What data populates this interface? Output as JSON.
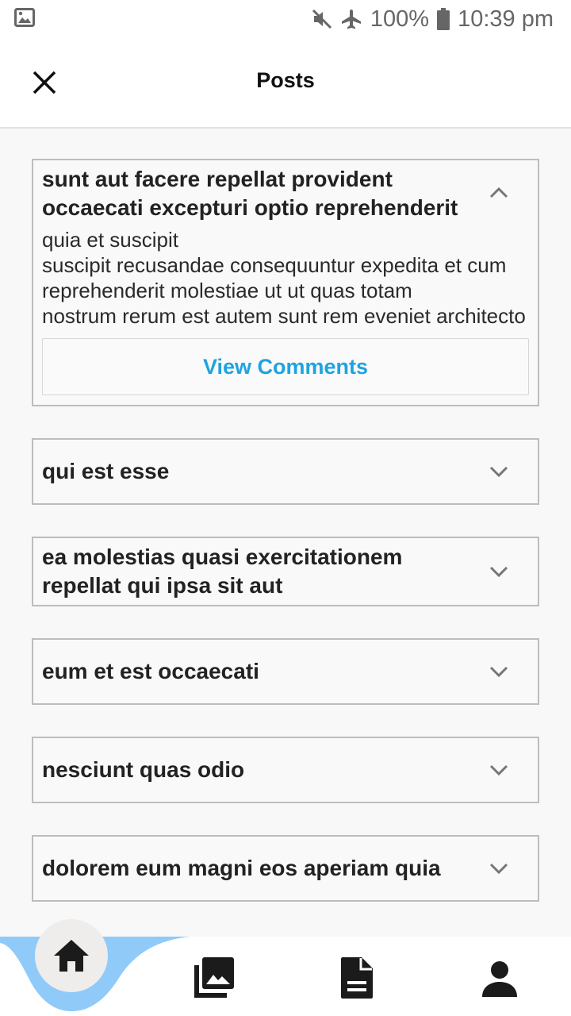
{
  "status_bar": {
    "battery_text": "100%",
    "time": "10:39 pm",
    "icons": [
      "image-icon",
      "mute-icon",
      "airplane-icon",
      "battery-icon"
    ]
  },
  "app_bar": {
    "title": "Posts",
    "close_icon": "close-icon"
  },
  "posts": [
    {
      "title": "sunt aut facere repellat provident occaecati excepturi optio reprehenderit",
      "body": "quia et suscipit\nsuscipit recusandae consequuntur expedita et cum\nreprehenderit molestiae ut ut quas totam\nnostrum rerum est autem sunt rem eveniet architecto",
      "expanded": true,
      "action_label": "View Comments"
    },
    {
      "title": "qui est esse",
      "expanded": false
    },
    {
      "title": "ea molestias quasi exercitationem repellat qui ipsa sit aut",
      "expanded": false
    },
    {
      "title": "eum et est occaecati",
      "expanded": false
    },
    {
      "title": "nesciunt quas odio",
      "expanded": false
    },
    {
      "title": "dolorem eum magni eos aperiam quia",
      "expanded": false
    }
  ],
  "bottom_nav": {
    "items": [
      "home-icon",
      "photos-icon",
      "document-icon",
      "person-icon"
    ],
    "active": "home-icon"
  },
  "colors": {
    "accent": "#1fa3e0",
    "nav_wave": "#90caf9",
    "card_border": "#bdbdbd",
    "background": "#f8f8f8"
  }
}
